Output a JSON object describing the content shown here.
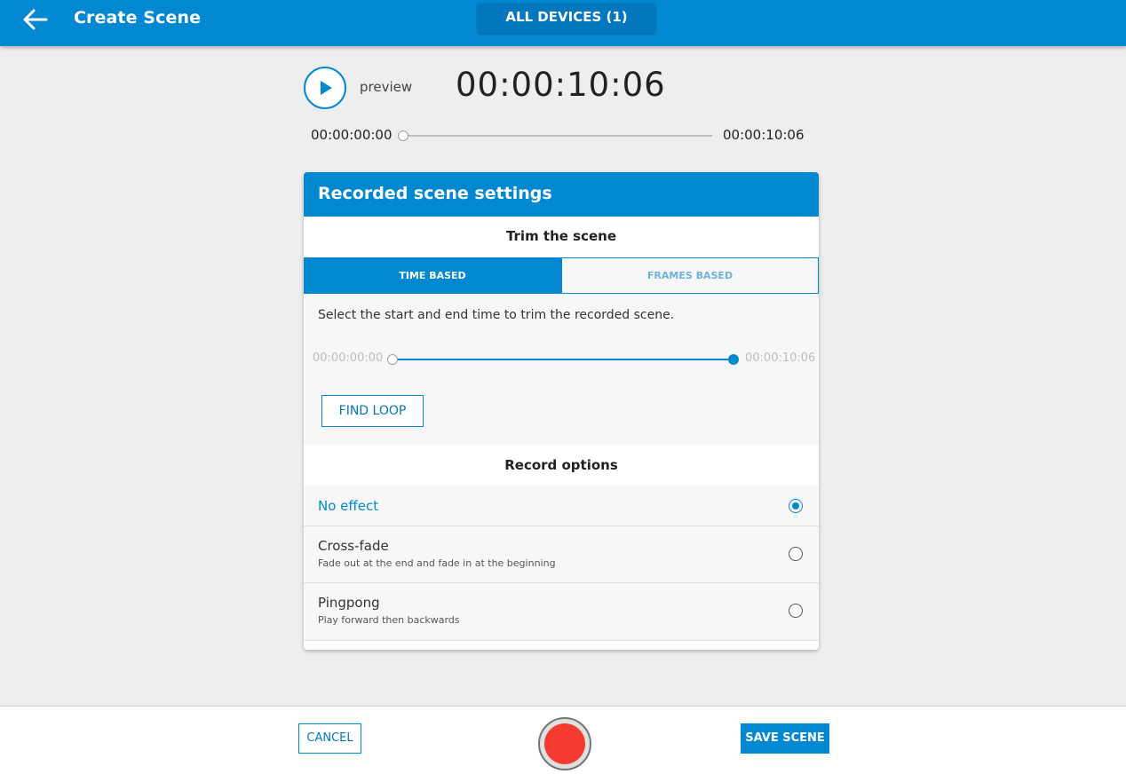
{
  "header": {
    "title": "Create Scene",
    "devices_label": "ALL DEVICES (1)"
  },
  "preview": {
    "label": "preview",
    "timecode": "00:00:10:06",
    "start_time": "00:00:00:00",
    "end_time": "00:00:10:06",
    "position_fraction": 0
  },
  "card": {
    "title": "Recorded scene settings",
    "trim": {
      "title": "Trim the scene",
      "tabs": [
        {
          "label": "TIME BASED",
          "active": true
        },
        {
          "label": "FRAMES BASED",
          "active": false
        }
      ],
      "description": "Select the start and end time to trim the recorded scene.",
      "start": "00:00:00:00",
      "end": "00:00:10:06",
      "range_fraction": [
        0,
        1
      ],
      "find_loop_label": "FIND LOOP"
    },
    "record_options": {
      "title": "Record options",
      "items": [
        {
          "label": "No effect",
          "description": "",
          "selected": true
        },
        {
          "label": "Cross-fade",
          "description": "Fade out at the end and fade in at the beginning",
          "selected": false
        },
        {
          "label": "Pingpong",
          "description": "Play forward then backwards",
          "selected": false
        }
      ]
    }
  },
  "footer": {
    "cancel_label": "CANCEL",
    "save_label": "SAVE SCENE"
  },
  "colors": {
    "primary": "#0288d1",
    "record": "#f53a2f"
  }
}
